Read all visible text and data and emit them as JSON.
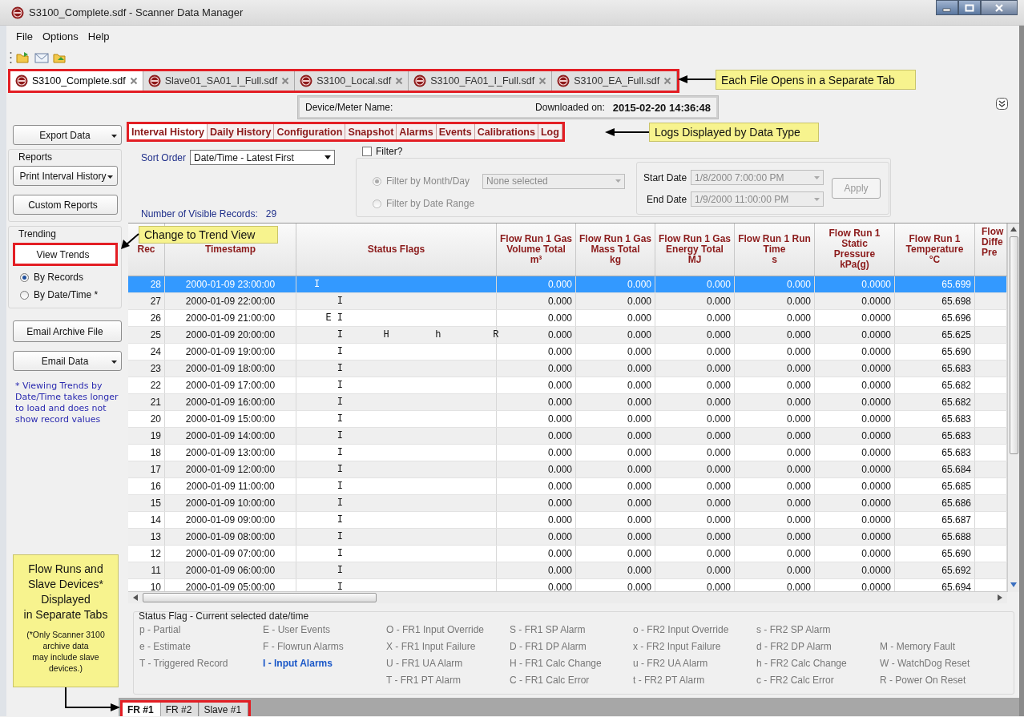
{
  "window": {
    "title": "S3100_Complete.sdf - Scanner Data Manager"
  },
  "menu": [
    "File",
    "Options",
    "Help"
  ],
  "file_tabs": [
    {
      "label": "S3100_Complete.sdf",
      "selected": true
    },
    {
      "label": "Slave01_SA01_I_Full.sdf",
      "selected": false
    },
    {
      "label": "S3100_Local.sdf",
      "selected": false
    },
    {
      "label": "S3100_FA01_I_Full.sdf",
      "selected": false
    },
    {
      "label": "S3100_EA_Full.sdf",
      "selected": false
    }
  ],
  "device": {
    "name_label": "Device/Meter Name:",
    "downloaded_label": "Downloaded on:",
    "downloaded_value": "2015-02-20 14:36:48"
  },
  "sidebar": {
    "export": "Export Data",
    "reports_title": "Reports",
    "print": "Print Interval History",
    "custom": "Custom Reports",
    "trending_title": "Trending",
    "view_trends": "View Trends",
    "trend_modes": [
      {
        "label": "By Records",
        "selected": true
      },
      {
        "label": "By Date/Time *",
        "selected": false
      }
    ],
    "email_archive": "Email Archive File",
    "email_data": "Email Data",
    "note": "* Viewing Trends by Date/Time takes longer to load and does not show record values"
  },
  "log_tabs": [
    {
      "label": "Interval History",
      "selected": true
    },
    {
      "label": "Daily History",
      "selected": false
    },
    {
      "label": "Configuration",
      "selected": false
    },
    {
      "label": "Snapshot",
      "selected": false
    },
    {
      "label": "Alarms",
      "selected": false
    },
    {
      "label": "Events",
      "selected": false
    },
    {
      "label": "Calibrations",
      "selected": false
    },
    {
      "label": "Log",
      "selected": false
    }
  ],
  "sort": {
    "label": "Sort Order",
    "value": "Date/Time - Latest First"
  },
  "filter": {
    "label": "Filter?",
    "checked": false,
    "disabled": true,
    "options": [
      {
        "label": "Filter by Month/Day",
        "selected": true
      },
      {
        "label": "Filter by Date Range",
        "selected": false
      }
    ],
    "month_day": "None selected",
    "start_label": "Start Date",
    "start_value": "1/8/2000 7:00:00 PM",
    "end_label": "End Date",
    "end_value": "1/9/2000 11:00:00 PM",
    "apply": "Apply"
  },
  "records": {
    "label": "Number of Visible Records:",
    "count": "29"
  },
  "table": {
    "columns": [
      {
        "lines": [
          "Rec"
        ]
      },
      {
        "lines": [
          "Timestamp"
        ]
      },
      {
        "lines": [
          "Status Flags"
        ]
      },
      {
        "lines": [
          "Flow Run 1 Gas",
          "Volume Total",
          "m³"
        ]
      },
      {
        "lines": [
          "Flow Run 1 Gas",
          "Mass Total",
          "kg"
        ]
      },
      {
        "lines": [
          "Flow Run 1 Gas",
          "Energy Total",
          "MJ"
        ]
      },
      {
        "lines": [
          "Flow Run 1 Run",
          "Time",
          "s"
        ]
      },
      {
        "lines": [
          "Flow Run 1",
          "Static",
          "Pressure",
          "kPa(g)"
        ]
      },
      {
        "lines": [
          "Flow Run 1",
          "Temperature",
          "°C"
        ]
      },
      {
        "lines": [
          "Flow",
          "Diffe",
          "Pre"
        ]
      }
    ],
    "rows": [
      {
        "selected": true,
        "cells": [
          "28",
          "2000-01-09 23:00:00",
          "I",
          "0.000",
          "0.000",
          "0.000",
          "0.000",
          "0.0000",
          "65.699"
        ]
      },
      {
        "selected": false,
        "cells": [
          "27",
          "2000-01-09 22:00:00",
          "    I",
          "0.000",
          "0.000",
          "0.000",
          "0.000",
          "0.0000",
          "65.698"
        ]
      },
      {
        "selected": false,
        "cells": [
          "26",
          "2000-01-09 21:00:00",
          "  E I",
          "0.000",
          "0.000",
          "0.000",
          "0.000",
          "0.0000",
          "65.696"
        ]
      },
      {
        "selected": false,
        "cells": [
          "25",
          "2000-01-09 20:00:00",
          "    I       H        h         R",
          "0.000",
          "0.000",
          "0.000",
          "0.000",
          "0.0000",
          "65.625"
        ]
      },
      {
        "selected": false,
        "cells": [
          "24",
          "2000-01-09 19:00:00",
          "    I",
          "0.000",
          "0.000",
          "0.000",
          "0.000",
          "0.0000",
          "65.690"
        ]
      },
      {
        "selected": false,
        "cells": [
          "23",
          "2000-01-09 18:00:00",
          "    I",
          "0.000",
          "0.000",
          "0.000",
          "0.000",
          "0.0000",
          "65.683"
        ]
      },
      {
        "selected": false,
        "cells": [
          "22",
          "2000-01-09 17:00:00",
          "    I",
          "0.000",
          "0.000",
          "0.000",
          "0.000",
          "0.0000",
          "65.682"
        ]
      },
      {
        "selected": false,
        "cells": [
          "21",
          "2000-01-09 16:00:00",
          "    I",
          "0.000",
          "0.000",
          "0.000",
          "0.000",
          "0.0000",
          "65.682"
        ]
      },
      {
        "selected": false,
        "cells": [
          "20",
          "2000-01-09 15:00:00",
          "    I",
          "0.000",
          "0.000",
          "0.000",
          "0.000",
          "0.0000",
          "65.683"
        ]
      },
      {
        "selected": false,
        "cells": [
          "19",
          "2000-01-09 14:00:00",
          "    I",
          "0.000",
          "0.000",
          "0.000",
          "0.000",
          "0.0000",
          "65.683"
        ]
      },
      {
        "selected": false,
        "cells": [
          "18",
          "2000-01-09 13:00:00",
          "    I",
          "0.000",
          "0.000",
          "0.000",
          "0.000",
          "0.0000",
          "65.683"
        ]
      },
      {
        "selected": false,
        "cells": [
          "17",
          "2000-01-09 12:00:00",
          "    I",
          "0.000",
          "0.000",
          "0.000",
          "0.000",
          "0.0000",
          "65.684"
        ]
      },
      {
        "selected": false,
        "cells": [
          "16",
          "2000-01-09 11:00:00",
          "    I",
          "0.000",
          "0.000",
          "0.000",
          "0.000",
          "0.0000",
          "65.685"
        ]
      },
      {
        "selected": false,
        "cells": [
          "15",
          "2000-01-09 10:00:00",
          "    I",
          "0.000",
          "0.000",
          "0.000",
          "0.000",
          "0.0000",
          "65.686"
        ]
      },
      {
        "selected": false,
        "cells": [
          "14",
          "2000-01-09 09:00:00",
          "    I",
          "0.000",
          "0.000",
          "0.000",
          "0.000",
          "0.0000",
          "65.687"
        ]
      },
      {
        "selected": false,
        "cells": [
          "13",
          "2000-01-09 08:00:00",
          "    I",
          "0.000",
          "0.000",
          "0.000",
          "0.000",
          "0.0000",
          "65.688"
        ]
      },
      {
        "selected": false,
        "cells": [
          "12",
          "2000-01-09 07:00:00",
          "    I",
          "0.000",
          "0.000",
          "0.000",
          "0.000",
          "0.0000",
          "65.690"
        ]
      },
      {
        "selected": false,
        "cells": [
          "11",
          "2000-01-09 06:00:00",
          "    I",
          "0.000",
          "0.000",
          "0.000",
          "0.000",
          "0.0000",
          "65.692"
        ]
      },
      {
        "selected": false,
        "cells": [
          "10",
          "2000-01-09 05:00:00",
          "    I",
          "0.000",
          "0.000",
          "0.000",
          "0.000",
          "0.0000",
          "65.694"
        ]
      }
    ]
  },
  "legend": {
    "title": "Status Flag - Current selected date/time",
    "columns": [
      {
        "items": [
          {
            "text": "p - Partial",
            "highlighted": false
          },
          {
            "text": "e - Estimate",
            "highlighted": false
          },
          {
            "text": "T - Triggered Record",
            "highlighted": false
          }
        ]
      },
      {
        "items": [
          {
            "text": "E - User Events",
            "highlighted": false
          },
          {
            "text": "F - Flowrun Alarms",
            "highlighted": false
          },
          {
            "text": "I - Input Alarms",
            "highlighted": true
          }
        ]
      },
      {
        "items": [
          {
            "text": "O - FR1 Input Override",
            "highlighted": false
          },
          {
            "text": "X - FR1 Input Failure",
            "highlighted": false
          },
          {
            "text": "U - FR1 UA Alarm",
            "highlighted": false
          },
          {
            "text": "T - FR1 PT Alarm",
            "highlighted": false
          }
        ]
      },
      {
        "items": [
          {
            "text": "S - FR1 SP Alarm",
            "highlighted": false
          },
          {
            "text": "D - FR1 DP Alarm",
            "highlighted": false
          },
          {
            "text": "H - FR1 Calc Change",
            "highlighted": false
          },
          {
            "text": "C - FR1 Calc Error",
            "highlighted": false
          }
        ]
      },
      {
        "items": [
          {
            "text": "o - FR2 Input Override",
            "highlighted": false
          },
          {
            "text": "x - FR2 Input Failure",
            "highlighted": false
          },
          {
            "text": "u - FR2 UA Alarm",
            "highlighted": false
          },
          {
            "text": "t - FR2 PT Alarm",
            "highlighted": false
          }
        ]
      },
      {
        "items": [
          {
            "text": "s - FR2 SP Alarm",
            "highlighted": false
          },
          {
            "text": "d - FR2 DP Alarm",
            "highlighted": false
          },
          {
            "text": "h - FR2 Calc Change",
            "highlighted": false
          },
          {
            "text": "c - FR2 Calc Error",
            "highlighted": false
          }
        ]
      },
      {
        "items": [
          {
            "text": "M - Memory Fault",
            "highlighted": false
          },
          {
            "text": "W - WatchDog Reset",
            "highlighted": false
          },
          {
            "text": "R - Power On Reset",
            "highlighted": false
          }
        ]
      }
    ]
  },
  "bottom_tabs": [
    {
      "label": "FR #1",
      "selected": true
    },
    {
      "label": "FR #2",
      "selected": false
    },
    {
      "label": "Slave #1",
      "selected": false
    }
  ],
  "annotations": {
    "file_tabs": "Each File Opens in a Separate Tab",
    "log_tabs": "Logs Displayed by Data Type",
    "trend": "Change to Trend View",
    "bottom_tabs": {
      "lines": [
        "Flow Runs and",
        "Slave Devices*",
        "Displayed",
        "in Separate Tabs"
      ],
      "footnote": [
        "(*Only Scanner 3100",
        "archive data",
        "may include slave",
        "devices.)"
      ]
    }
  }
}
